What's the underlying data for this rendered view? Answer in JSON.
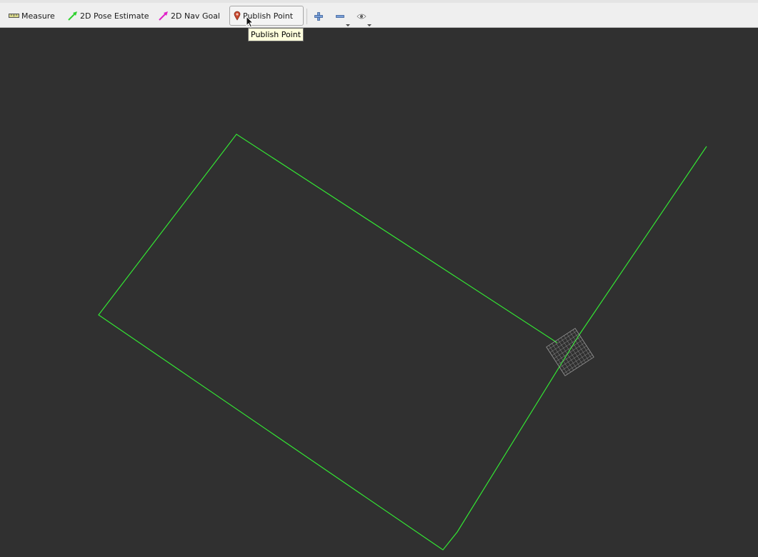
{
  "toolbar": {
    "tools": [
      {
        "label": "Measure",
        "icon": "ruler-icon"
      },
      {
        "label": "2D Pose Estimate",
        "icon": "green-arrow-icon"
      },
      {
        "label": "2D Nav Goal",
        "icon": "magenta-arrow-icon"
      },
      {
        "label": "Publish Point",
        "icon": "map-pin-icon",
        "active": true
      }
    ],
    "view_buttons": [
      "zoom-in-icon",
      "zoom-out-icon",
      "eye-icon"
    ]
  },
  "tooltip": {
    "text": "Publish Point"
  },
  "viewport": {
    "background": "#303030",
    "path_color": "#33e633",
    "grid_color": "#9a9a9a"
  }
}
